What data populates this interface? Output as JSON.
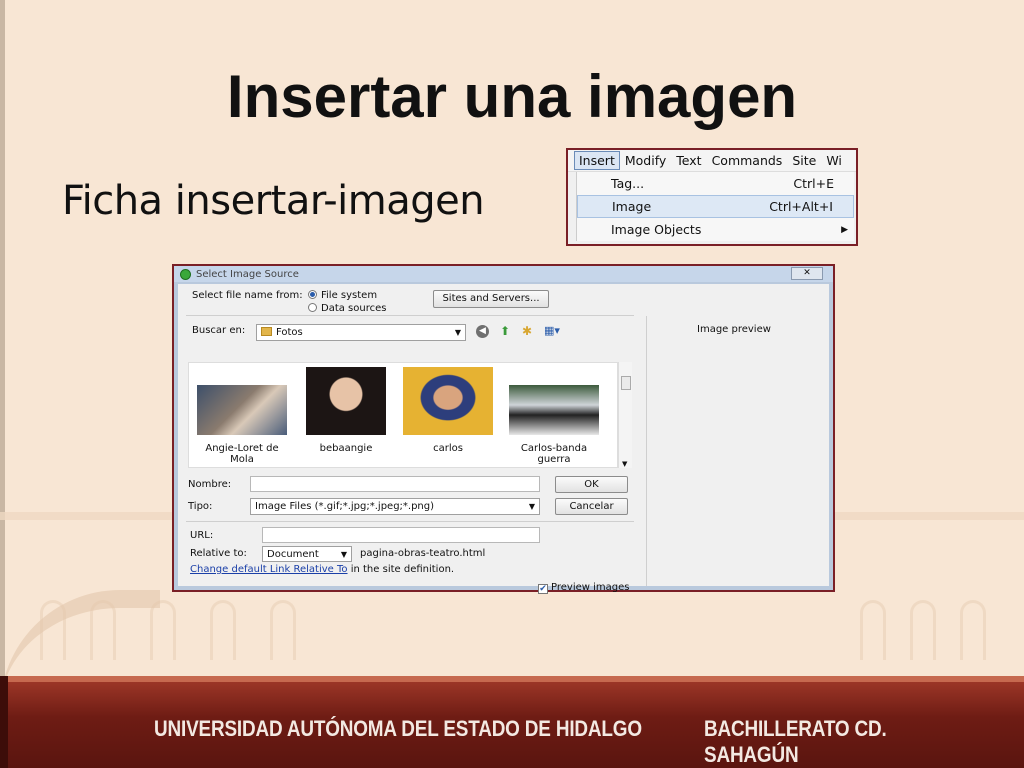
{
  "slide": {
    "title": "Insertar una imagen",
    "subtitle": "Ficha insertar-imagen"
  },
  "menu": {
    "bar": [
      "Insert",
      "Modify",
      "Text",
      "Commands",
      "Site",
      "Wi"
    ],
    "items": [
      {
        "label": "Tag...",
        "shortcut": "Ctrl+E"
      },
      {
        "label": "Image",
        "shortcut": "Ctrl+Alt+I"
      },
      {
        "label": "Image Objects",
        "shortcut": ""
      }
    ]
  },
  "dialog": {
    "title": "Select Image Source",
    "close_label": "✕",
    "select_file_label": "Select file name from:",
    "radio_file_system": "File system",
    "radio_data_sources": "Data sources",
    "sites_button": "Sites and Servers...",
    "buscar_label": "Buscar en:",
    "folder": "Fotos",
    "preview_label": "Image preview",
    "thumbnails": [
      {
        "name": "Angie-Loret de Mola",
        "line1": "Angie-Loret de",
        "line2": "Mola"
      },
      {
        "name": "bebaangie",
        "line1": "bebaangie",
        "line2": ""
      },
      {
        "name": "carlos",
        "line1": "carlos",
        "line2": ""
      },
      {
        "name": "Carlos-banda guerra",
        "line1": "Carlos-banda",
        "line2": "guerra"
      }
    ],
    "nombre_label": "Nombre:",
    "nombre_value": "",
    "tipo_label": "Tipo:",
    "tipo_value": "Image Files (*.gif;*.jpg;*.jpeg;*.png)",
    "ok_button": "OK",
    "cancel_button": "Cancelar",
    "url_label": "URL:",
    "url_value": "",
    "relative_label": "Relative to:",
    "relative_value": "Document",
    "relative_file": "pagina-obras-teatro.html",
    "change_link": "Change default Link Relative To",
    "change_suffix": "in the site definition.",
    "preview_checkbox": "Preview images"
  },
  "footer": {
    "left": "UNIVERSIDAD AUTÓNOMA DEL ESTADO DE HIDALGO",
    "right": "BACHILLERATO CD. SAHAGÚN"
  },
  "colors": {
    "background": "#f8e6d4",
    "footer": "#6e1c14",
    "frame": "#7a1f26"
  }
}
